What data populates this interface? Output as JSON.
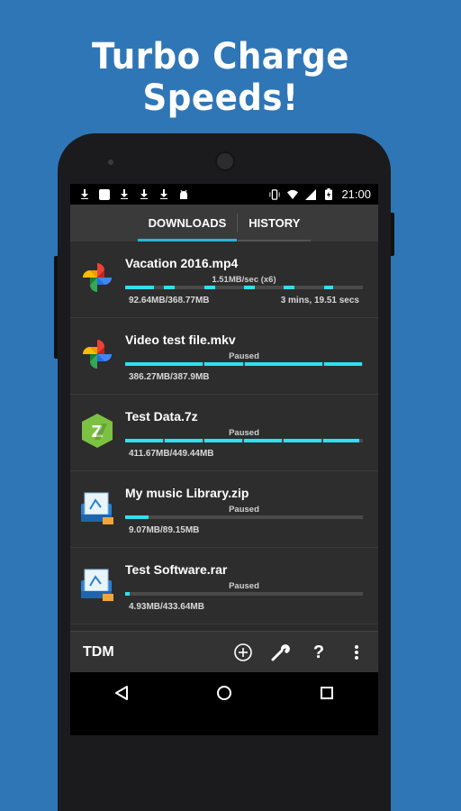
{
  "headline": "Turbo Charge Speeds!",
  "status_bar": {
    "time": "21:00"
  },
  "tabs": [
    {
      "label": "DOWNLOADS",
      "active": true
    },
    {
      "label": "HISTORY",
      "active": false
    }
  ],
  "downloads": [
    {
      "name": "Vacation 2016.mp4",
      "status": "1.51MB/sec (x6)",
      "size": "92.64MB/368.77MB",
      "eta": "3 mins, 19.51 secs",
      "icon": "photos-pinwheel-icon",
      "progress": 0.25
    },
    {
      "name": "Video test file.mkv",
      "status": "Paused",
      "size": "386.27MB/387.9MB",
      "eta": "",
      "icon": "photos-pinwheel-icon",
      "progress": 0.99
    },
    {
      "name": "Test Data.7z",
      "status": "Paused",
      "size": "411.67MB/449.44MB",
      "eta": "",
      "icon": "zarchiver-icon",
      "progress": 0.92
    },
    {
      "name": "My music Library.zip",
      "status": "Paused",
      "size": "9.07MB/89.15MB",
      "eta": "",
      "icon": "archive-box-icon",
      "progress": 0.1
    },
    {
      "name": "Test Software.rar",
      "status": "Paused",
      "size": "4.93MB/433.64MB",
      "eta": "",
      "icon": "archive-box-icon",
      "progress": 0.02
    }
  ],
  "bottom_bar": {
    "app_name": "TDM"
  },
  "colors": {
    "background": "#2f76b6",
    "accent": "#2ee0f0",
    "tab_indicator": "#29b6d6"
  }
}
